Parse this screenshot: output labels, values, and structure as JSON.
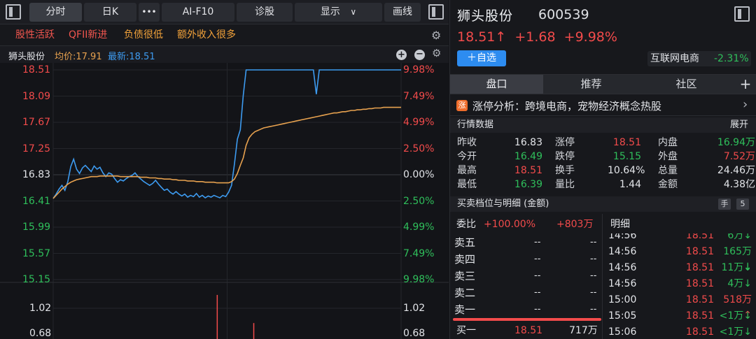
{
  "toolbar": {
    "tabs": [
      "分时",
      "日K"
    ],
    "more": "•••",
    "ai_f10": "AI-F10",
    "diagnose": "诊股",
    "display": "显示",
    "display_arrow": "∨",
    "draw": "画线"
  },
  "tags": [
    {
      "label": "股性活跃",
      "color": "#f0554e"
    },
    {
      "label": "QFII新进",
      "color": "#f0554e"
    },
    {
      "label": "负债很低",
      "color": "#f2a23a"
    },
    {
      "label": "额外收入很多",
      "color": "#f2a23a"
    }
  ],
  "chart_header": {
    "name": "狮头股份",
    "avg_label": "均价:17.91",
    "latest_label": "最新:18.51"
  },
  "chart_data": {
    "type": "line",
    "price_axis": [
      "18.51",
      "18.09",
      "17.67",
      "17.25",
      "16.83",
      "16.41",
      "15.99",
      "15.57",
      "15.15"
    ],
    "pct_axis": [
      "9.98%",
      "7.49%",
      "4.99%",
      "2.50%",
      "0.00%",
      "2.50%",
      "4.99%",
      "7.49%",
      "9.98%"
    ],
    "volume_axis": [
      "1.02",
      "0.68"
    ],
    "ylim": [
      15.15,
      18.51
    ],
    "series": [
      {
        "color": "#3d9bf0",
        "values": [
          16.45,
          16.52,
          16.6,
          16.66,
          16.58,
          16.72,
          16.96,
          17.08,
          16.92,
          16.85,
          16.94,
          16.98,
          16.93,
          16.88,
          16.97,
          16.92,
          16.95,
          16.86,
          16.8,
          16.86,
          16.84,
          16.77,
          16.71,
          16.75,
          16.73,
          16.77,
          16.8,
          16.82,
          16.86,
          16.8,
          16.76,
          16.72,
          16.69,
          16.66,
          16.69,
          16.74,
          16.68,
          16.63,
          16.58,
          16.6,
          16.55,
          16.52,
          16.56,
          16.52,
          16.49,
          16.52,
          16.47,
          16.5,
          16.48,
          16.53,
          16.47,
          16.5,
          16.46,
          16.49,
          16.47,
          16.5,
          16.48,
          16.46,
          16.5,
          16.48,
          16.55,
          16.66,
          17.0,
          17.4,
          17.55,
          18.1,
          18.51,
          18.51,
          18.51,
          18.51,
          18.51,
          18.51,
          18.51,
          18.51,
          18.51,
          18.51,
          18.51,
          18.51,
          18.51,
          18.51,
          18.51,
          18.51,
          18.51,
          18.51,
          18.51,
          18.51,
          18.51,
          18.51,
          18.51,
          18.51,
          18.12,
          18.51,
          18.51,
          18.51,
          18.51,
          18.51,
          18.51,
          18.51,
          18.51,
          18.51,
          18.51,
          18.51,
          18.51,
          18.51,
          18.51,
          18.51,
          18.51,
          18.51,
          18.51,
          18.51,
          18.51,
          18.51,
          18.51,
          18.51,
          18.51,
          18.51,
          18.51,
          18.51,
          18.51,
          18.51
        ]
      },
      {
        "color": "#e8a24f",
        "values": [
          16.45,
          16.5,
          16.55,
          16.6,
          16.64,
          16.68,
          16.71,
          16.73,
          16.75,
          16.76,
          16.77,
          16.78,
          16.79,
          16.8,
          16.8,
          16.8,
          16.81,
          16.81,
          16.81,
          16.81,
          16.81,
          16.81,
          16.81,
          16.8,
          16.8,
          16.8,
          16.8,
          16.8,
          16.8,
          16.8,
          16.79,
          16.79,
          16.79,
          16.78,
          16.78,
          16.78,
          16.77,
          16.77,
          16.76,
          16.76,
          16.76,
          16.75,
          16.75,
          16.74,
          16.74,
          16.74,
          16.73,
          16.73,
          16.73,
          16.72,
          16.72,
          16.72,
          16.71,
          16.71,
          16.71,
          16.71,
          16.7,
          16.7,
          16.7,
          16.7,
          16.7,
          16.72,
          16.76,
          16.85,
          16.98,
          17.1,
          17.3,
          17.42,
          17.48,
          17.52,
          17.54,
          17.56,
          17.58,
          17.59,
          17.6,
          17.61,
          17.62,
          17.63,
          17.64,
          17.65,
          17.66,
          17.67,
          17.68,
          17.69,
          17.7,
          17.71,
          17.72,
          17.73,
          17.74,
          17.75,
          17.76,
          17.77,
          17.78,
          17.79,
          17.8,
          17.81,
          17.82,
          17.82,
          17.83,
          17.84,
          17.84,
          17.85,
          17.86,
          17.86,
          17.87,
          17.87,
          17.88,
          17.88,
          17.89,
          17.89,
          17.9,
          17.9,
          17.9,
          17.91,
          17.91,
          17.91,
          17.91,
          17.91,
          17.91,
          17.91
        ]
      }
    ],
    "volume_bars": [
      {
        "x": 0.47,
        "value": 1.2
      },
      {
        "x": 0.575,
        "value": 0.82
      }
    ]
  },
  "stock": {
    "name": "狮头股份",
    "code": "600539",
    "price": "18.51↑",
    "change": "+1.68",
    "pct": "+9.98%",
    "add_watch": "＋自选",
    "sector_name": "互联网电商",
    "sector_pct": "-2.31%"
  },
  "panel_tabs": [
    "盘口",
    "推荐",
    "社区"
  ],
  "panel_plus": "+",
  "limit_analysis": {
    "icon": "涨",
    "text": "涨停分析：跨境电商，宠物经济概念热股",
    "chevron": "›"
  },
  "quote_section": {
    "title": "行情数据",
    "expand": "展开"
  },
  "quotes": [
    [
      [
        "昨收",
        "16.83",
        "w"
      ],
      [
        "涨停",
        "18.51",
        "r"
      ],
      [
        "内盘",
        "16.94万",
        "g"
      ]
    ],
    [
      [
        "今开",
        "16.49",
        "g"
      ],
      [
        "跌停",
        "15.15",
        "g"
      ],
      [
        "外盘",
        "7.52万",
        "r"
      ]
    ],
    [
      [
        "最高",
        "18.51",
        "r"
      ],
      [
        "换手",
        "10.64%",
        "w"
      ],
      [
        "总量",
        "24.46万",
        "w"
      ]
    ],
    [
      [
        "最低",
        "16.39",
        "g"
      ],
      [
        "量比",
        "1.44",
        "w"
      ],
      [
        "金额",
        "4.38亿",
        "w"
      ]
    ]
  ],
  "orderbook_section": {
    "title": "买卖档位与明细 (金额)",
    "badge1": "手",
    "badge2": "5"
  },
  "orderbook": {
    "ratio_label": "委比",
    "ratio_pct": "+100.00%",
    "ratio_amt": "+803万",
    "asks": [
      {
        "label": "卖五",
        "price": "--",
        "vol": "--"
      },
      {
        "label": "卖四",
        "price": "--",
        "vol": "--"
      },
      {
        "label": "卖三",
        "price": "--",
        "vol": "--"
      },
      {
        "label": "卖二",
        "price": "--",
        "vol": "--"
      },
      {
        "label": "卖一",
        "price": "--",
        "vol": "--"
      }
    ],
    "bid1": {
      "label": "买一",
      "price": "18.51",
      "vol": "717万"
    },
    "detail_title": "明细",
    "trades": [
      {
        "time": "14:56",
        "price": "18.51",
        "vol": "6万↓",
        "dir": "g"
      },
      {
        "time": "14:56",
        "price": "18.51",
        "vol": "165万↓",
        "dir": "g"
      },
      {
        "time": "14:56",
        "price": "18.51",
        "vol": "11万↓",
        "dir": "g"
      },
      {
        "time": "14:56",
        "price": "18.51",
        "vol": "4万↓",
        "dir": "g"
      },
      {
        "time": "15:00",
        "price": "18.51",
        "vol": "518万↑",
        "dir": "r"
      },
      {
        "time": "15:05",
        "price": "18.51",
        "vol": "<1万↓",
        "dir": "g"
      },
      {
        "time": "15:06",
        "price": "18.51",
        "vol": "<1万↓",
        "dir": "g"
      }
    ]
  },
  "colors": {
    "red": "#f24b4b",
    "green": "#2fbf5b",
    "white": "#e3e5e9",
    "label": "#d5d7dc"
  }
}
